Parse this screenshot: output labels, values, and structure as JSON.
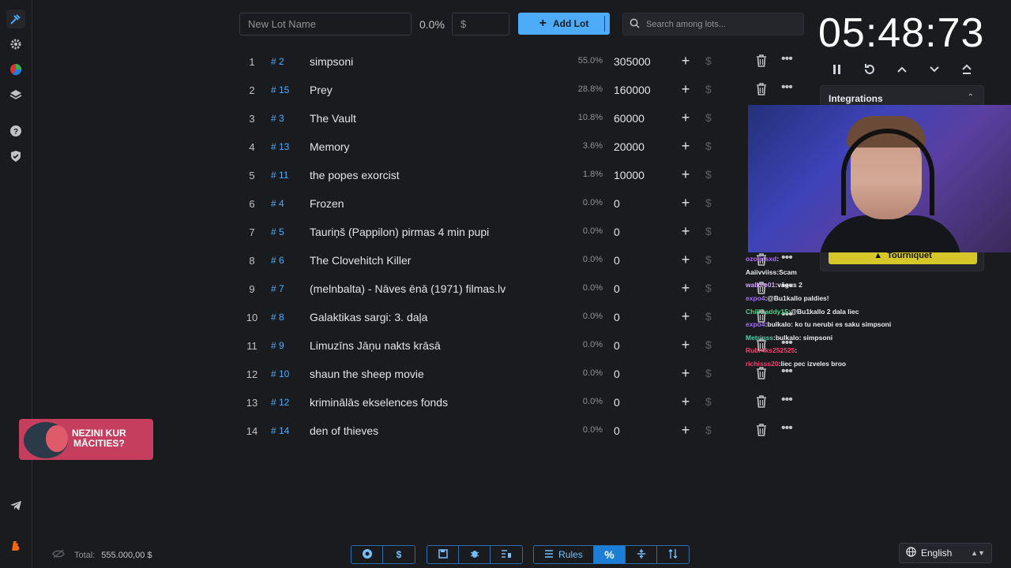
{
  "toolbar": {
    "lot_name_placeholder": "New Lot Name",
    "percent_total": "0.0%",
    "amount_placeholder": "$",
    "add_lot_label": "Add Lot",
    "search_placeholder": "Search among lots..."
  },
  "timer": {
    "display": "05:48:73"
  },
  "integrations": {
    "title": "Integrations",
    "tournament_button": "Tourniquet"
  },
  "lots": [
    {
      "index": "1",
      "id": "# 2",
      "name": "simpsoni",
      "percent": "55.0%",
      "amount": "305000"
    },
    {
      "index": "2",
      "id": "# 15",
      "name": "Prey",
      "percent": "28.8%",
      "amount": "160000"
    },
    {
      "index": "3",
      "id": "# 3",
      "name": "The Vault",
      "percent": "10.8%",
      "amount": "60000"
    },
    {
      "index": "4",
      "id": "# 13",
      "name": "Memory",
      "percent": "3.6%",
      "amount": "20000"
    },
    {
      "index": "5",
      "id": "# 11",
      "name": "the popes exorcist",
      "percent": "1.8%",
      "amount": "10000"
    },
    {
      "index": "6",
      "id": "# 4",
      "name": "Frozen",
      "percent": "0.0%",
      "amount": "0"
    },
    {
      "index": "7",
      "id": "# 5",
      "name": "Tauriņš (Pappilon) pirmas 4 min pupi",
      "percent": "0.0%",
      "amount": "0"
    },
    {
      "index": "8",
      "id": "# 6",
      "name": "The Clovehitch Killer",
      "percent": "0.0%",
      "amount": "0"
    },
    {
      "index": "9",
      "id": "# 7",
      "name": "(melnbalta) - Nāves ēnā (1971) filmas.lv",
      "percent": "0.0%",
      "amount": "0"
    },
    {
      "index": "10",
      "id": "# 8",
      "name": "Galaktikas sargi: 3. daļa",
      "percent": "0.0%",
      "amount": "0"
    },
    {
      "index": "11",
      "id": "# 9",
      "name": "Limuzīns Jāņu nakts krāsā",
      "percent": "0.0%",
      "amount": "0"
    },
    {
      "index": "12",
      "id": "# 10",
      "name": "shaun the sheep movie",
      "percent": "0.0%",
      "amount": "0"
    },
    {
      "index": "13",
      "id": "# 12",
      "name": "kriminālās ekselences fonds",
      "percent": "0.0%",
      "amount": "0"
    },
    {
      "index": "14",
      "id": "# 14",
      "name": "den of thieves",
      "percent": "0.0%",
      "amount": "0"
    }
  ],
  "row_actions": {
    "plus": "+",
    "dollar": "$",
    "more": "•••"
  },
  "chat": [
    {
      "user": "ozolinsxd",
      "color": "#b06cff",
      "msg": ""
    },
    {
      "user": "Aaiivviiss",
      "color": "#e9ecef",
      "msg": "Scam"
    },
    {
      "user": "walkee01",
      "color": "#d6a6ff",
      "msg": "vāgus 2"
    },
    {
      "user": "expo4",
      "color": "#a56cff",
      "msg": "@Bu1kallo paldies!"
    },
    {
      "user": "ChillDaddy15",
      "color": "#4fd18b",
      "msg": "@Bu1kallo 2 dala liec"
    },
    {
      "user": "expo4",
      "color": "#a56cff",
      "msg": "bulkalo: ko tu nerubi es saku simpsoni"
    },
    {
      "user": "Metrinss",
      "color": "#4fd1a5",
      "msg": "bulkalo: simpsoni"
    },
    {
      "user": "Rubr4ks252525",
      "color": "#ff3d6e",
      "msg": ""
    },
    {
      "user": "richisss20",
      "color": "#ff3d6e",
      "msg": "liec pec izveles broo"
    }
  ],
  "promo": {
    "line1": "NEZINI KUR",
    "line2": "MĀCITIES?"
  },
  "footer": {
    "total_label": "Total:",
    "total_value": "555.000,00 $",
    "rules_label": "Rules",
    "percent_label": "%",
    "language": "English"
  }
}
